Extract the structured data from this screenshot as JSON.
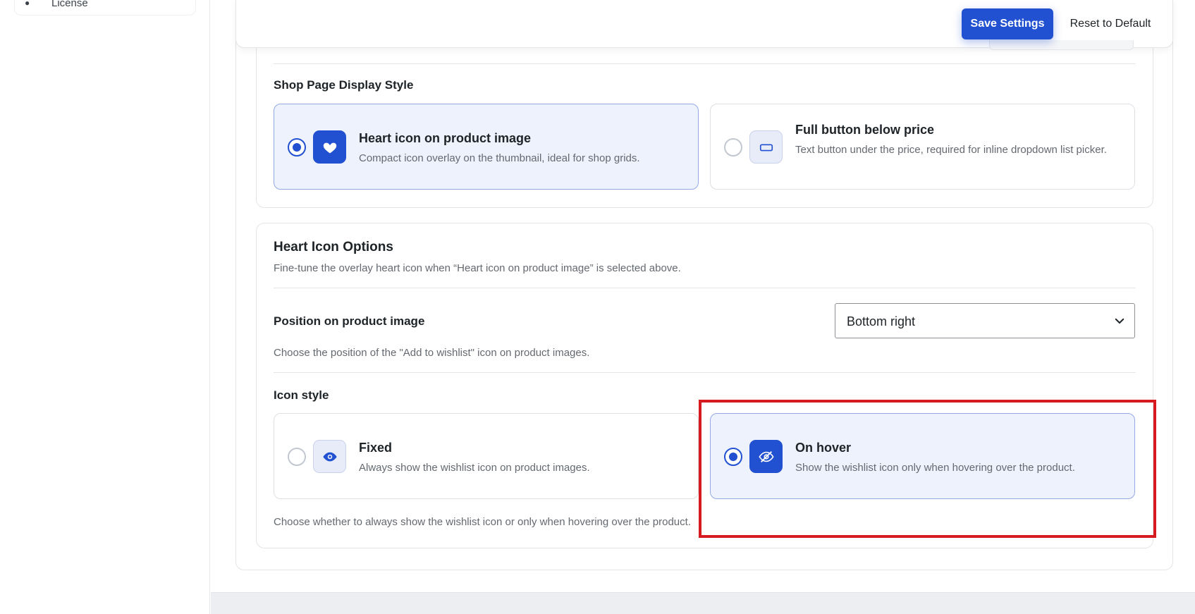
{
  "sidebar": {
    "license_label": "License"
  },
  "header": {
    "ghost_title": "",
    "save_label": "Save Settings",
    "reset_label": "Reset to Default"
  },
  "shop_display": {
    "label": "Shop Page Display Style",
    "options": [
      {
        "title": "Heart icon on product image",
        "desc": "Compact icon overlay on the thumbnail, ideal for shop grids.",
        "icon": "heart-icon",
        "selected": true
      },
      {
        "title": "Full button below price",
        "desc": "Text button under the price, required for inline dropdown list picker.",
        "icon": "button-icon",
        "selected": false
      }
    ]
  },
  "heart_options": {
    "title": "Heart Icon Options",
    "subtitle": "Fine-tune the overlay heart icon when “Heart icon on product image” is selected above.",
    "position": {
      "label": "Position on product image",
      "value": "Bottom right",
      "help": "Choose the position of the \"Add to wishlist\" icon on product images."
    },
    "icon_style": {
      "label": "Icon style",
      "options": [
        {
          "title": "Fixed",
          "desc": "Always show the wishlist icon on product images.",
          "icon": "eye-icon",
          "selected": false
        },
        {
          "title": "On hover",
          "desc": "Show the wishlist icon only when hovering over the product.",
          "icon": "eye-off-icon",
          "selected": true
        }
      ],
      "help": "Choose whether to always show the wishlist icon or only when hovering over the product."
    }
  },
  "colors": {
    "accent": "#2151d1",
    "selected_bg": "#eef2fd",
    "highlight": "#d71920"
  }
}
